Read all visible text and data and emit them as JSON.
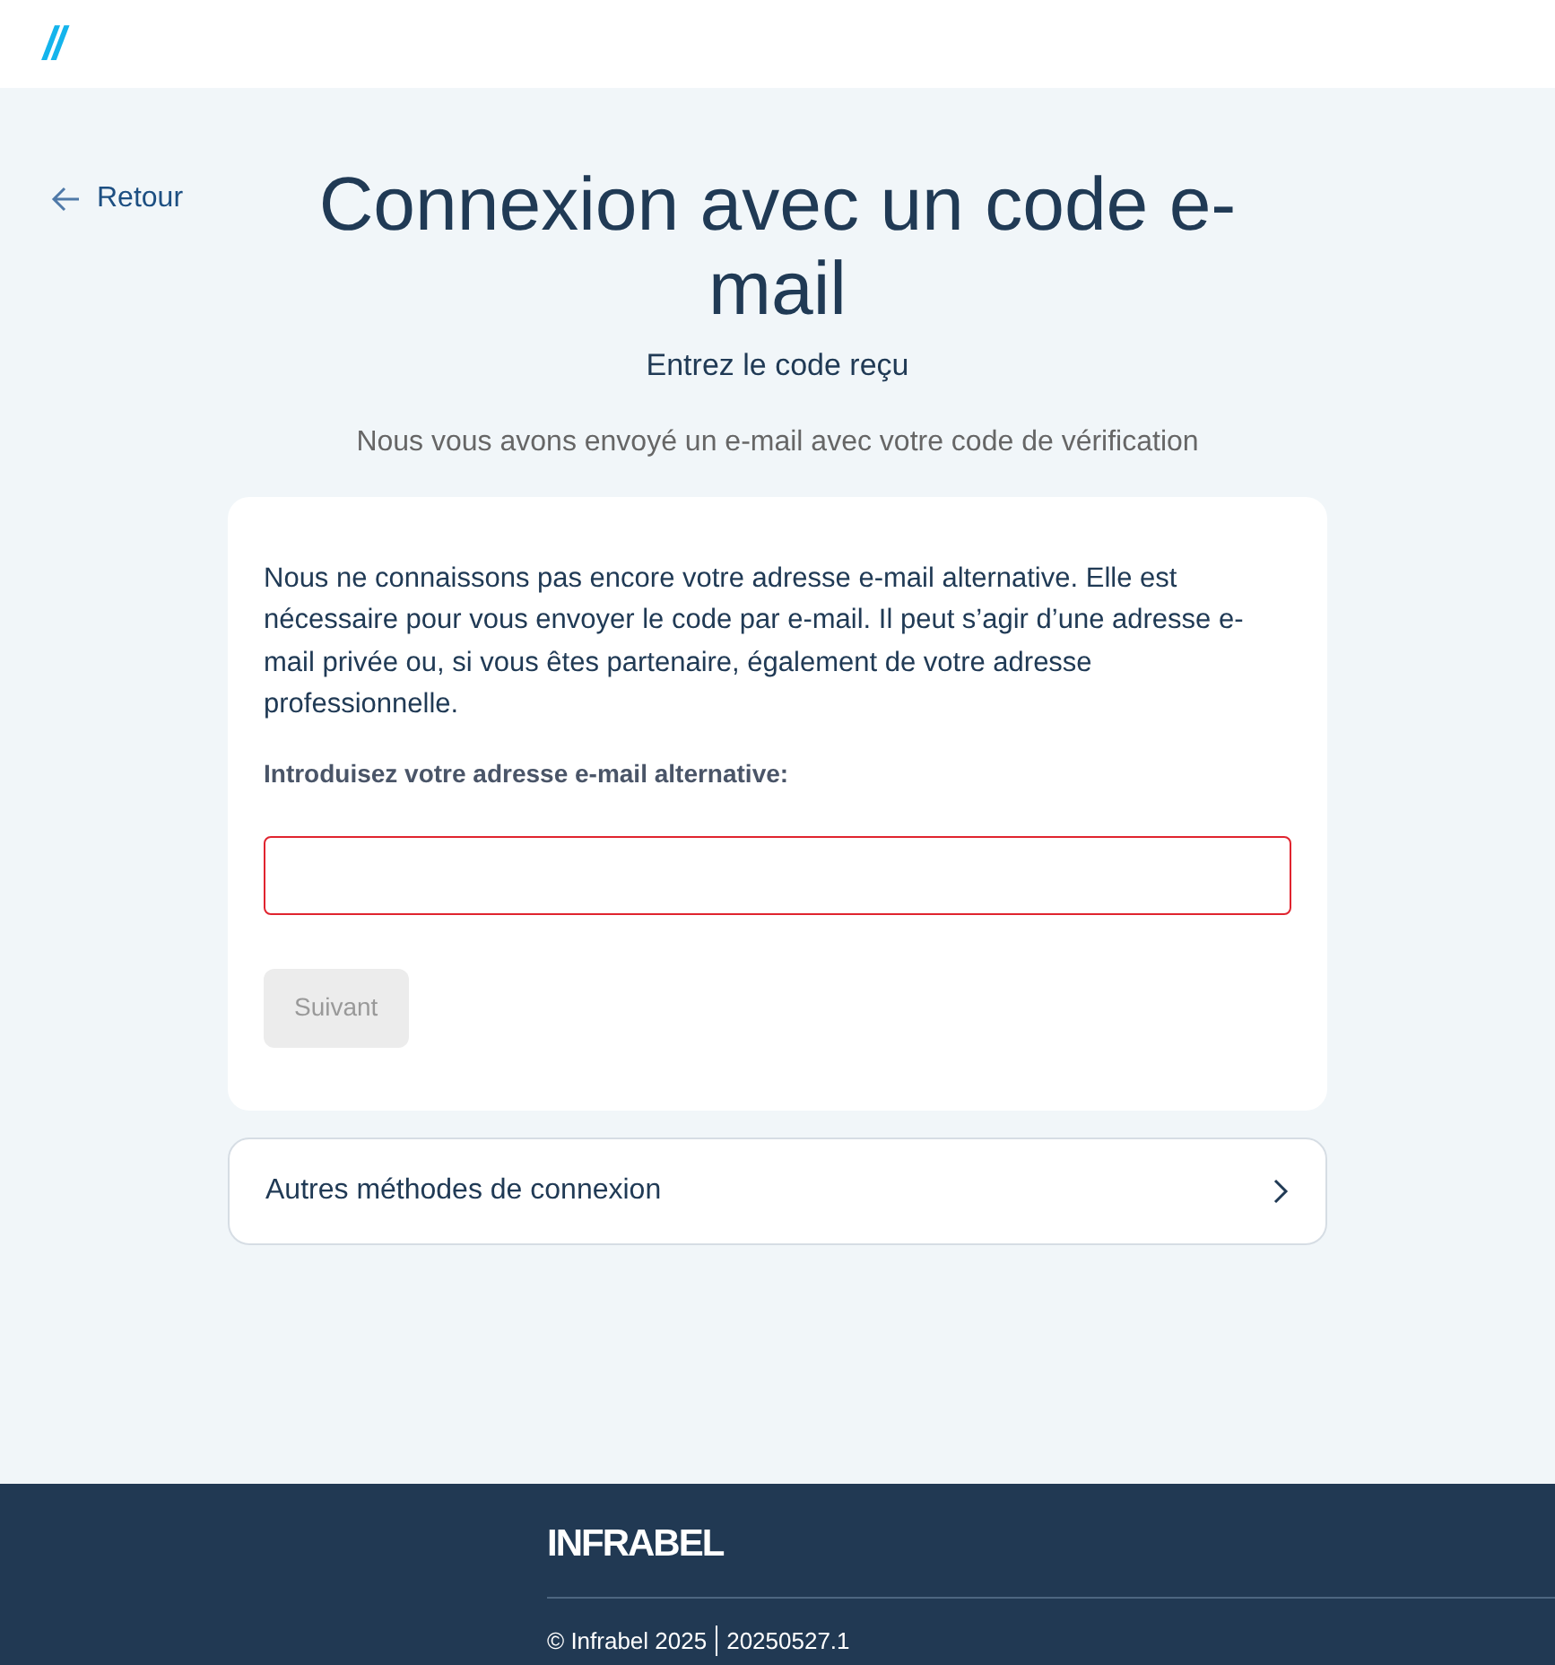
{
  "header": {
    "logo": "//"
  },
  "back_link": {
    "label": "Retour"
  },
  "title": "Connexion avec un code e-mail",
  "subtitle": "Entrez le code reçu",
  "info": "Nous vous avons envoyé un e-mail avec votre code de vérification",
  "card": {
    "message": "Nous ne connaissons pas encore votre adresse e-mail alternative. Elle est nécessaire pour vous envoyer le code par e-mail. Il peut s’agir d’une adresse e-mail privée ou, si vous êtes partenaire, également de votre adresse professionnelle.",
    "field_label": "Introduisez votre adresse e-mail alternative:",
    "field": {
      "invalid": true
    },
    "button": {
      "label": "Suivant",
      "disabled": true
    }
  },
  "other_methods": {
    "label": "Autres méthodes de connexion"
  },
  "footer": {
    "logo": "INFRABEL",
    "copyright": "© Infrabel 2025",
    "version": "20250527.1"
  }
}
